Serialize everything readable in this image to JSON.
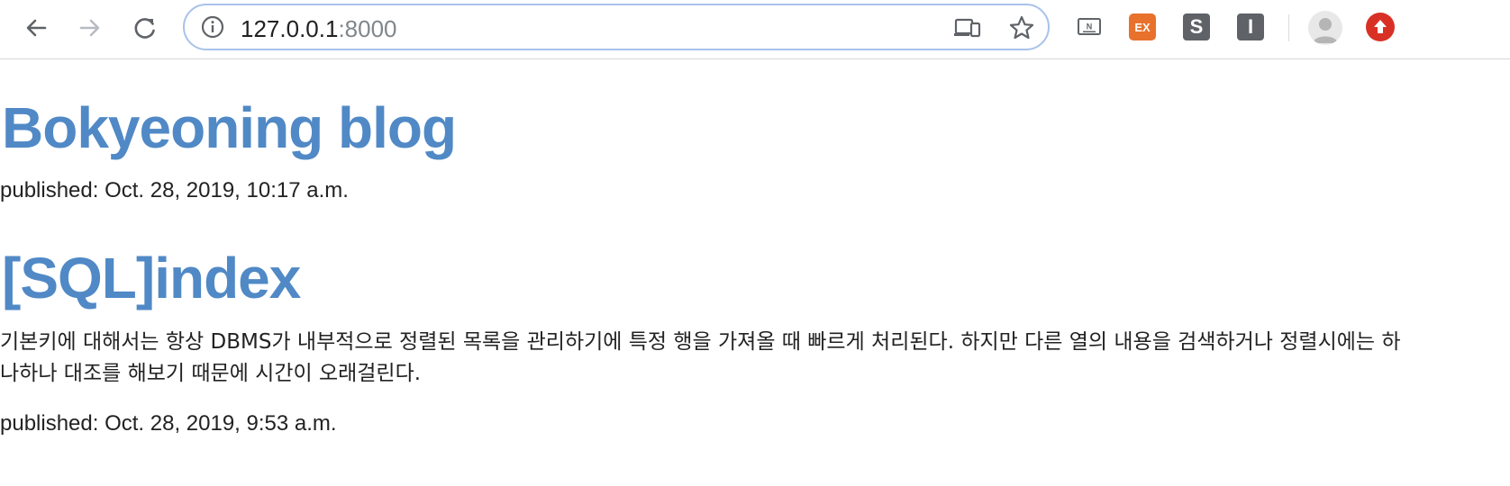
{
  "browser": {
    "url_host": "127.0.0.1",
    "url_port": ":8000",
    "extensions": [
      {
        "label": "N"
      },
      {
        "label": "EX"
      },
      {
        "label": "S"
      },
      {
        "label": "I"
      }
    ],
    "colors": {
      "focus_ring": "#a8c2ea",
      "ext_ex": "#e8712c",
      "ext_dark": "#5f6368",
      "update": "#d93025"
    }
  },
  "blog": {
    "title": "Bokyeoning blog",
    "title_color": "#5089c6",
    "posts": [
      {
        "title": "",
        "text": "",
        "published": "published: Oct. 28, 2019, 10:17 a.m."
      },
      {
        "title": "[SQL]index",
        "text": "기본키에 대해서는 항상 DBMS가 내부적으로 정렬된 목록을 관리하기에 특정 행을 가져올 때 빠르게 처리된다. 하지만 다른 열의 내용을 검색하거나 정렬시에는 하나하나 대조를 해보기 때문에 시간이 오래걸린다.",
        "published": "published: Oct. 28, 2019, 9:53 a.m."
      }
    ]
  }
}
